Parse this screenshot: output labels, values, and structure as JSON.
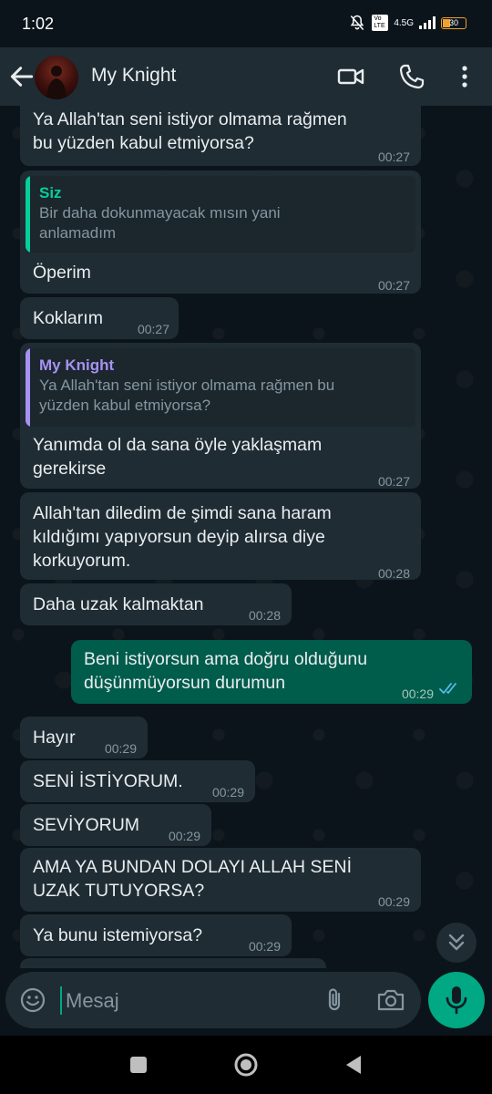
{
  "status_bar": {
    "time": "1:02",
    "network": "4.5G",
    "volte": "Vo LTE",
    "battery": "30"
  },
  "header": {
    "contact_name": "My Knight"
  },
  "messages": [
    {
      "direction": "in",
      "lines": [
        "Ya Allah'tan seni istiyor olmama rağmen",
        "bu yüzden kabul etmiyorsa?"
      ],
      "time": "00:27"
    },
    {
      "direction": "in",
      "quote": {
        "author": "Siz",
        "lines": [
          "Bir daha dokunmayacak mısın yani",
          "anlamadım"
        ]
      },
      "lines": [
        "Öperim"
      ],
      "time": "00:27"
    },
    {
      "direction": "in",
      "lines": [
        "Koklarım"
      ],
      "time": "00:27"
    },
    {
      "direction": "in",
      "quote": {
        "author": "My Knight",
        "lines": [
          "Ya Allah'tan seni istiyor olmama rağmen bu",
          "yüzden kabul etmiyorsa?"
        ]
      },
      "lines": [
        "Yanımda ol da sana öyle yaklaşmam",
        "gerekirse"
      ],
      "time": "00:27"
    },
    {
      "direction": "in",
      "lines": [
        "Allah'tan diledim de şimdi sana haram",
        "kıldığımı yapıyorsun deyip alırsa diye",
        "korkuyorum."
      ],
      "time": "00:28"
    },
    {
      "direction": "in",
      "lines": [
        "Daha uzak kalmaktan"
      ],
      "time": "00:28"
    },
    {
      "direction": "out",
      "lines": [
        "Beni istiyorsun ama doğru olduğunu",
        "düşünmüyorsun durumun"
      ],
      "time": "00:29",
      "read": true
    },
    {
      "direction": "in",
      "lines": [
        "Hayır"
      ],
      "time": "00:29"
    },
    {
      "direction": "in",
      "lines": [
        "SENİ İSTİYORUM."
      ],
      "time": "00:29"
    },
    {
      "direction": "in",
      "lines": [
        "SEVİYORUM"
      ],
      "time": "00:29"
    },
    {
      "direction": "in",
      "lines": [
        "AMA YA BUNDAN DOLAYI ALLAH SENİ",
        "UZAK TUTUYORSA?"
      ],
      "time": "00:29"
    },
    {
      "direction": "in",
      "lines": [
        "Ya bunu istemiyorsa?"
      ],
      "time": "00:29"
    }
  ],
  "composer": {
    "placeholder": "Mesaj"
  },
  "icons": {
    "back": "arrow-left-icon",
    "video": "video-call-icon",
    "call": "phone-icon",
    "menu": "more-vert-icon",
    "scroll": "double-chevron-down-icon",
    "emoji": "emoji-icon",
    "attach": "paperclip-icon",
    "camera": "camera-icon",
    "mic": "microphone-icon",
    "read": "double-check-icon"
  },
  "colors": {
    "background": "#0b141a",
    "bar": "#1f2c33",
    "incoming": "#1f2c34",
    "outgoing": "#005c4b",
    "accent": "#00a884",
    "quote_you": "#06cf9c",
    "quote_contact": "#a791f4",
    "read_tick": "#53bdeb"
  }
}
